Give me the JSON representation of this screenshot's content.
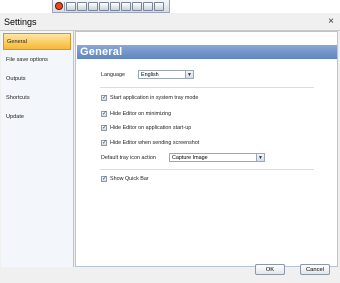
{
  "window": {
    "title": "Settings",
    "close_glyph": "×"
  },
  "sidebar": {
    "items": [
      {
        "label": "General",
        "active": true
      },
      {
        "label": "File save options",
        "active": false
      },
      {
        "label": "Outputs",
        "active": false
      },
      {
        "label": "Shortcuts",
        "active": false
      },
      {
        "label": "Update",
        "active": false
      }
    ]
  },
  "main": {
    "title": "General",
    "language_label": "Language",
    "language_value": "English",
    "checkboxes": [
      {
        "label": "Start application in system tray mode",
        "checked": true
      },
      {
        "label": "Hide Editor on minimizing",
        "checked": true
      },
      {
        "label": "Hide Editor on application start-up",
        "checked": true
      },
      {
        "label": "Hide Editor when sending screenshot",
        "checked": true
      }
    ],
    "tray_action_label": "Default tray icon action",
    "tray_action_value": "Capture Image",
    "quick_bar": {
      "label": "Show Quick Bar",
      "checked": true
    }
  },
  "buttons": {
    "ok": "OK",
    "cancel": "Cancel"
  },
  "icons": {
    "check": "✓",
    "dropdown": "▼"
  },
  "colors": {
    "accent_orange": "#f7b733",
    "header_blue": "#6f95c9"
  }
}
